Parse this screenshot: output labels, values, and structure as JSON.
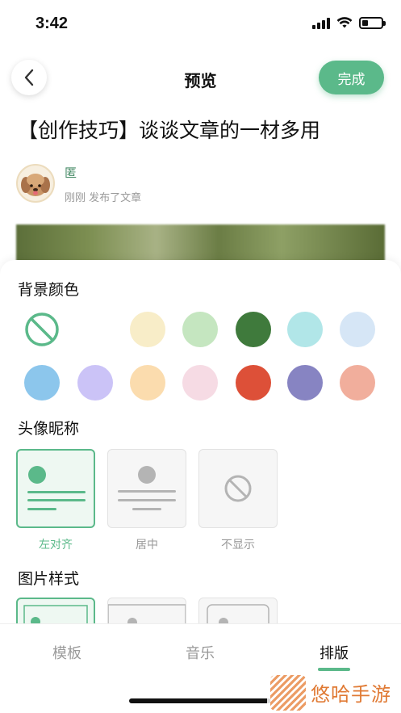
{
  "status_bar": {
    "time": "3:42"
  },
  "nav": {
    "title": "预览",
    "done_label": "完成"
  },
  "article": {
    "title": "【创作技巧】谈谈文章的一材多用",
    "author_name": "匿",
    "meta": "刚刚  发布了文章"
  },
  "sheet": {
    "bg_color_title": "背景颜色",
    "bg_colors": [
      {
        "name": "none",
        "color": ""
      },
      {
        "name": "white",
        "color": "#ffffff"
      },
      {
        "name": "cream",
        "color": "#f8edc8"
      },
      {
        "name": "light-green",
        "color": "#c5e6c0"
      },
      {
        "name": "dark-green",
        "color": "#3f7a3c"
      },
      {
        "name": "aqua",
        "color": "#b1e6e8"
      },
      {
        "name": "pale-blue",
        "color": "#d6e6f6"
      },
      {
        "name": "sky-blue",
        "color": "#8cc6ec"
      },
      {
        "name": "lavender",
        "color": "#cbc3f7"
      },
      {
        "name": "peach",
        "color": "#fbdcae"
      },
      {
        "name": "pink",
        "color": "#f6dbe4"
      },
      {
        "name": "red",
        "color": "#dd5038"
      },
      {
        "name": "purple",
        "color": "#8784c2"
      },
      {
        "name": "salmon",
        "color": "#f1ae9c"
      }
    ],
    "avatar_title": "头像昵称",
    "avatar_options": [
      {
        "label": "左对齐",
        "selected": true
      },
      {
        "label": "居中",
        "selected": false
      },
      {
        "label": "不显示",
        "selected": false
      }
    ],
    "image_title": "图片样式"
  },
  "tabs": [
    {
      "label": "模板",
      "active": false
    },
    {
      "label": "音乐",
      "active": false
    },
    {
      "label": "排版",
      "active": true
    }
  ],
  "watermark": {
    "text": "悠哈手游"
  },
  "colors": {
    "accent": "#5bb98a",
    "author": "#4a8d69"
  }
}
